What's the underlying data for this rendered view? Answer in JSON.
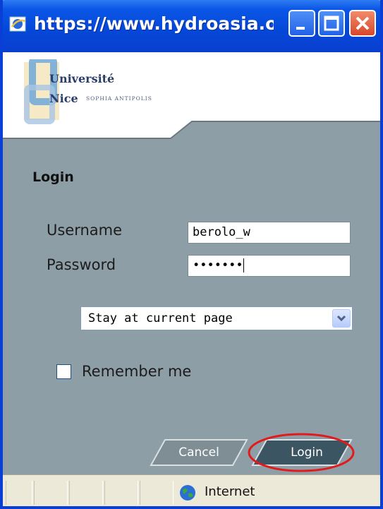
{
  "window": {
    "title": "https://www.hydroasia.o...",
    "controls": [
      "minimize",
      "maximize",
      "close"
    ]
  },
  "header": {
    "logo_line1": "Université",
    "logo_line2": "Nice",
    "logo_line3": "SOPHIA ANTIPOLIS"
  },
  "form": {
    "title": "Login",
    "username_label": "Username",
    "username_value": "berolo_w",
    "password_label": "Password",
    "password_value": "•••••••",
    "redirect_select": "Stay at current page",
    "remember_label": "Remember me",
    "remember_checked": false,
    "cancel_label": "Cancel",
    "login_label": "Login"
  },
  "statusbar": {
    "zone": "Internet"
  },
  "colors": {
    "titlebar": "#0a56e6",
    "content_bg": "#8e9ea6",
    "button_dark": "#3b5563",
    "button_light": "#7f8e94",
    "highlight_ring": "#e11b1b"
  },
  "icons": [
    "ie-icon",
    "minimize-icon",
    "maximize-icon",
    "close-icon",
    "chevron-down-icon",
    "globe-icon"
  ]
}
